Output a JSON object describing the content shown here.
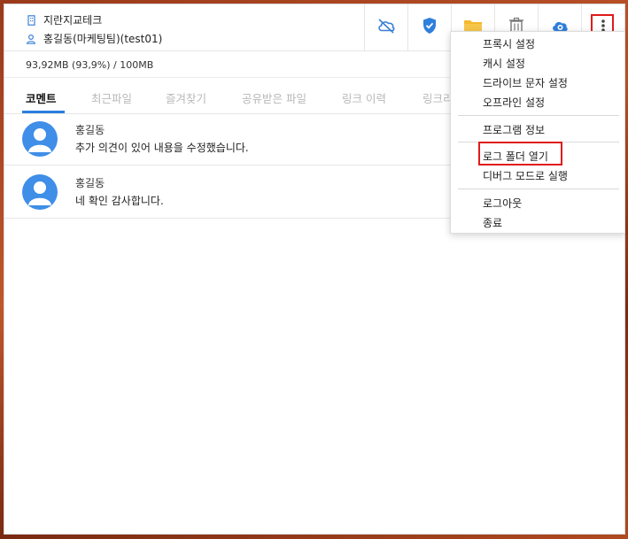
{
  "header": {
    "company": "지란지교테크",
    "user": "홍길동(마케팅팀)(test01)"
  },
  "toolbar": {
    "buttons": [
      {
        "icon": "cloud-off-icon"
      },
      {
        "icon": "shield-check-icon"
      },
      {
        "icon": "folder-icon"
      },
      {
        "icon": "trash-icon"
      },
      {
        "icon": "sync-icon"
      },
      {
        "icon": "more-vertical-icon"
      }
    ]
  },
  "storage": {
    "text": "93,92MB (93,9%) / 100MB"
  },
  "tabs": [
    {
      "label": "코멘트",
      "active": true
    },
    {
      "label": "최근파일"
    },
    {
      "label": "즐겨찾기"
    },
    {
      "label": "공유받은 파일"
    },
    {
      "label": "링크 이력"
    },
    {
      "label": "링크리"
    }
  ],
  "comments": [
    {
      "name": "홍길동",
      "text": "추가 의견이 있어 내용을 수정했습니다."
    },
    {
      "name": "홍길동",
      "text": "네 확인 감사합니다."
    }
  ],
  "menu": {
    "group1": [
      "프록시 설정",
      "캐시 설정",
      "드라이브 문자 설정",
      "오프라인 설정"
    ],
    "group2": [
      "프로그램 정보"
    ],
    "group3": [
      "로그 폴더 열기",
      "디버그 모드로 실행"
    ],
    "group4": [
      "로그아웃",
      "종료"
    ]
  },
  "colors": {
    "accent": "#2b7de0",
    "highlight": "#e01b1b",
    "avatar": "#3f8ee8",
    "folder": "#f5b82e"
  }
}
